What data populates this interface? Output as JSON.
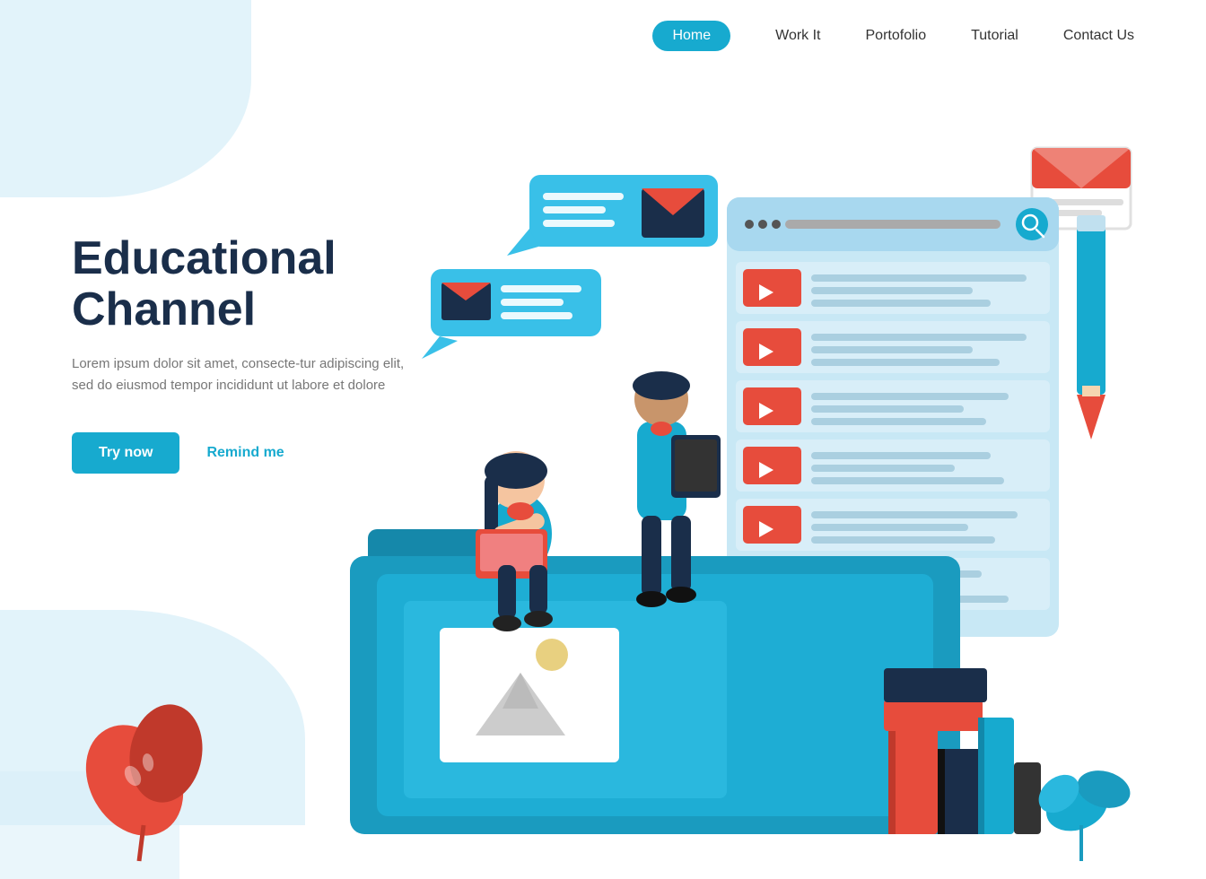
{
  "nav": {
    "items": [
      {
        "label": "Home",
        "active": true
      },
      {
        "label": "Work It",
        "active": false
      },
      {
        "label": "Portofolio",
        "active": false
      },
      {
        "label": "Tutorial",
        "active": false
      },
      {
        "label": "Contact Us",
        "active": false
      }
    ]
  },
  "hero": {
    "title": "Educational Channel",
    "subtitle": "Lorem ipsum dolor sit amet, consecte-tur adipiscing elit, sed do eiusmod tempor incididunt ut labore et dolore",
    "btn_primary": "Try now",
    "btn_secondary": "Remind me"
  },
  "colors": {
    "primary": "#17aacf",
    "dark": "#1a2e4a",
    "red": "#e74c3c",
    "folder": "#1a9bbf",
    "light_blue": "#d6eef8",
    "bubble": "#39c0e8"
  }
}
